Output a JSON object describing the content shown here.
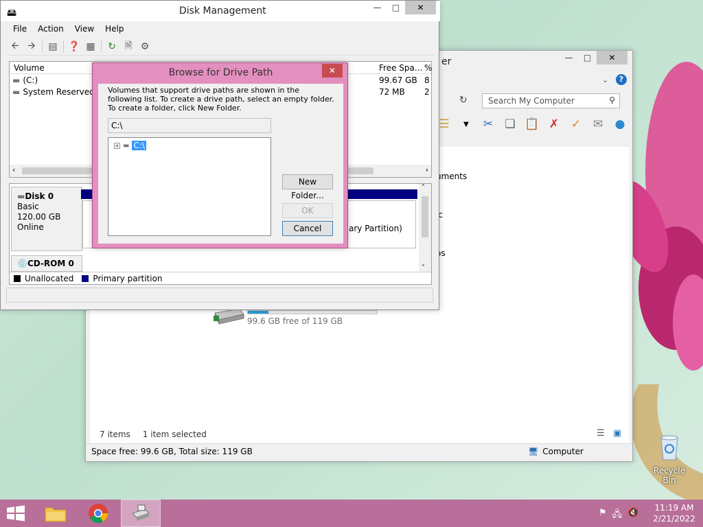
{
  "explorer": {
    "title_partial": "er",
    "search_placeholder": "Search My Computer",
    "side_items": [
      "uments",
      "ic",
      "os"
    ],
    "drive_free": "99.6 GB free of 119 GB",
    "drive_fill_fraction": 0.16,
    "status_items": "7 items",
    "status_selected": "1 item selected",
    "status_space": "Space free: 99.6 GB, Total size: 119 GB",
    "status_location": "Computer"
  },
  "disk_management": {
    "title": "Disk Management",
    "menu": [
      "File",
      "Action",
      "View",
      "Help"
    ],
    "volume_header": {
      "volume": "Volume",
      "free_space": "Free Spa...",
      "percent": "%"
    },
    "volumes": [
      {
        "name": "(C:)",
        "free": "99.67 GB",
        "pct": "8"
      },
      {
        "name": "System Reserved",
        "free": "72 MB",
        "pct": "2"
      }
    ],
    "disks": [
      {
        "name": "Disk 0",
        "type": "Basic",
        "size": "120.00 GB",
        "status": "Online"
      },
      {
        "name": "CD-ROM 0"
      }
    ],
    "partition_text": "ary Partition)",
    "legend": [
      {
        "label": "Unallocated",
        "color": "#000000"
      },
      {
        "label": "Primary partition",
        "color": "#000080"
      }
    ]
  },
  "browse_dialog": {
    "title": "Browse for Drive Path",
    "description": "Volumes that support drive paths are shown in the following list. To create a drive path, select an empty folder. To create a folder, click New Folder.",
    "path_value": "C:\\",
    "tree_item": "C:\\",
    "new_folder_label": "New Folder...",
    "ok_label": "OK",
    "cancel_label": "Cancel"
  },
  "desktop": {
    "recycle_bin_label": "Recycle Bin"
  },
  "taskbar": {
    "time": "11:19 AM",
    "date": "2/21/2022"
  }
}
